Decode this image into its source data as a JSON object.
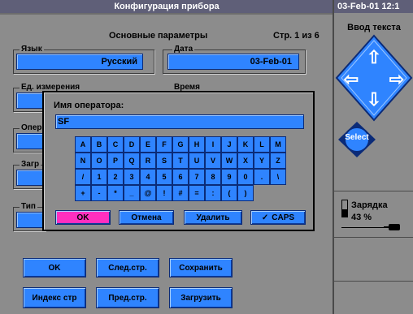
{
  "title": "Конфигурация прибора",
  "datetime": "03-Feb-01 12:1",
  "section_title": "Основные параметры",
  "page_indicator": "Стр. 1 из 6",
  "fields": {
    "language": {
      "label": "Язык",
      "value": "Русский"
    },
    "date": {
      "label": "Дата",
      "value": "03-Feb-01"
    },
    "units": {
      "label": "Ед. измерения"
    },
    "time": {
      "label": "Время"
    },
    "operator": {
      "label": "Опер"
    },
    "load": {
      "label": "Загр"
    },
    "type": {
      "label": "Тип"
    }
  },
  "dialog": {
    "prompt": "Имя оператора:",
    "input_value": "SF",
    "keys": [
      [
        "A",
        "B",
        "C",
        "D",
        "E",
        "F",
        "G",
        "H",
        "I",
        "J",
        "K",
        "L",
        "M"
      ],
      [
        "N",
        "O",
        "P",
        "Q",
        "R",
        "S",
        "T",
        "U",
        "V",
        "W",
        "X",
        "Y",
        "Z"
      ],
      [
        "/",
        "1",
        "2",
        "3",
        "4",
        "5",
        "6",
        "7",
        "8",
        "9",
        "0",
        ".",
        "\\"
      ],
      [
        "+",
        "-",
        "*",
        "_",
        "@",
        "!",
        "#",
        "=",
        ":",
        "(",
        ")"
      ]
    ],
    "buttons": {
      "ok": "OK",
      "cancel": "Отмена",
      "delete": "Удалить",
      "caps": "CAPS",
      "caps_mark": "✓"
    },
    "colors": {
      "ok_button": "#ff2fbf"
    }
  },
  "side_panel": {
    "title": "Ввод текста",
    "arrows": {
      "up": "⇧",
      "down": "⇩",
      "left": "⇦",
      "right": "⇨"
    },
    "select_label": "Select",
    "battery": {
      "label": "Зарядка",
      "percent": "43 %"
    }
  },
  "bottom_buttons": {
    "ok": "OK",
    "next_page": "След.стр.",
    "save": "Сохранить",
    "page_index": "Индекс стр",
    "prev_page": "Пред.стр.",
    "load": "Загрузить"
  }
}
